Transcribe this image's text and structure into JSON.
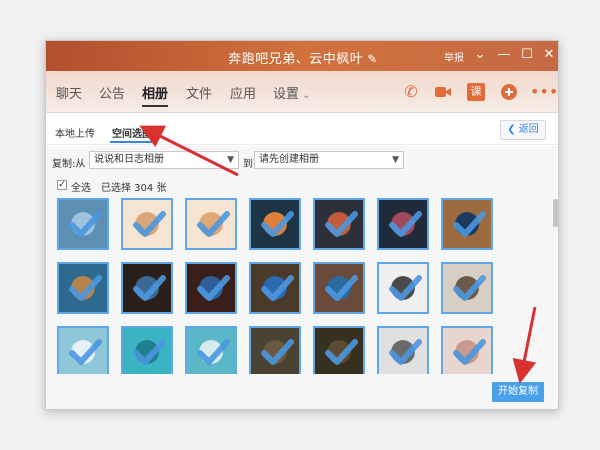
{
  "window": {
    "title": "奔跑吧兄弟、云中枫叶",
    "report": "举报",
    "controls": [
      "chevron-down-icon",
      "minimize-icon",
      "maximize-icon",
      "close-icon"
    ]
  },
  "tabs": [
    {
      "label": "聊天"
    },
    {
      "label": "公告"
    },
    {
      "label": "相册",
      "active": true
    },
    {
      "label": "文件"
    },
    {
      "label": "应用"
    },
    {
      "label": "设置"
    }
  ],
  "tab_icons": [
    "phone-icon",
    "video-icon",
    "classroom-icon",
    "add-icon",
    "more-icon"
  ],
  "classroom_icon_text": "课",
  "subtabs": {
    "local_upload": "本地上传",
    "space_select": "空间选图",
    "back": "返回"
  },
  "copy": {
    "from_label": "复制:从",
    "from_value": "说说和日志相册",
    "to_label": "到",
    "to_value": "请先创建相册"
  },
  "selection": {
    "select_all": "全选",
    "selected_text": "已选择 304 张",
    "select_all_checked": true
  },
  "photos": [
    {
      "colors": [
        "#5d8fb3",
        "#9ec3df"
      ]
    },
    {
      "colors": [
        "#f4e6d3",
        "#d9a77a"
      ]
    },
    {
      "colors": [
        "#f7e5d3",
        "#e0a877"
      ]
    },
    {
      "colors": [
        "#1d3444",
        "#e07f3a"
      ]
    },
    {
      "colors": [
        "#2b2f3a",
        "#c45b3a"
      ]
    },
    {
      "colors": [
        "#1f2a3a",
        "#a14a5c"
      ]
    },
    {
      "colors": [
        "#9b6a3f",
        "#1b3a5c"
      ]
    },
    {
      "colors": [
        "#2e6a8f",
        "#b8824b"
      ]
    },
    {
      "colors": [
        "#2a1f1a",
        "#3c6a94"
      ]
    },
    {
      "colors": [
        "#3a1e1a",
        "#2f5f98"
      ]
    },
    {
      "colors": [
        "#4a3a2a",
        "#2c6ab0"
      ]
    },
    {
      "colors": [
        "#6a4a3a",
        "#2a6a9f"
      ]
    },
    {
      "colors": [
        "#f0f0f0",
        "#4a4a4a"
      ]
    },
    {
      "colors": [
        "#d8cfc4",
        "#6a5a4a"
      ]
    },
    {
      "colors": [
        "#8ec7d8",
        "#e6f2f6"
      ]
    },
    {
      "colors": [
        "#3ab3c2",
        "#1e7f8f"
      ]
    },
    {
      "colors": [
        "#59b7c8",
        "#d8ecef"
      ]
    },
    {
      "colors": [
        "#4a4232",
        "#6a5a40"
      ]
    },
    {
      "colors": [
        "#35301f",
        "#5a4b32"
      ]
    },
    {
      "colors": [
        "#e0e0e0",
        "#6a6a6a"
      ]
    },
    {
      "colors": [
        "#e8d6cf",
        "#c89a8e"
      ]
    }
  ],
  "start_button": "开始复制",
  "colors": {
    "title_gradient_start": "#b24f2d",
    "title_gradient_end": "#d1713d",
    "accent_blue": "#4aa0ea",
    "annotation_red": "#d93030",
    "check_blue": "#4a97e0"
  }
}
